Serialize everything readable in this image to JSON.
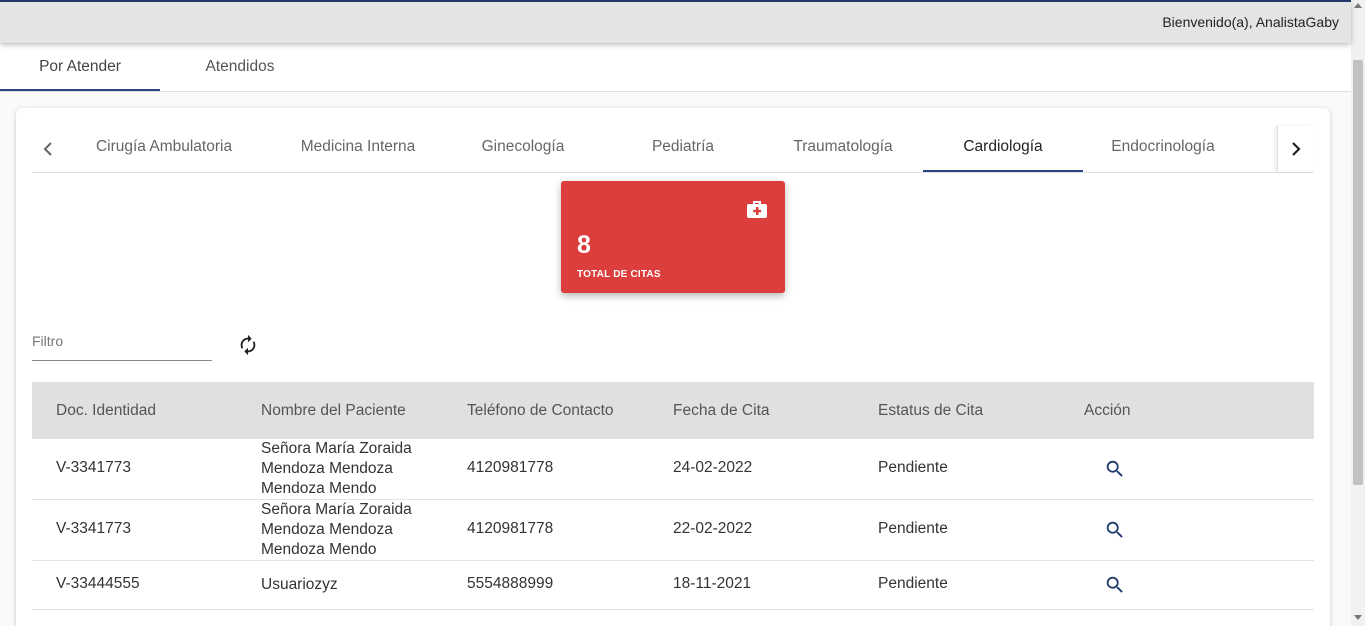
{
  "header": {
    "welcome": "Bienvenido(a), AnalistaGaby"
  },
  "main_tabs": [
    {
      "label": "Por Atender",
      "active": true
    },
    {
      "label": "Atendidos",
      "active": false
    }
  ],
  "specialties": {
    "tabs": [
      "Cirugía Ambulatoria",
      "Medicina Interna",
      "Ginecología",
      "Pediatría",
      "Traumatología",
      "Cardiología",
      "Endocrinología"
    ],
    "active": "Cardiología"
  },
  "stat_card": {
    "value": "8",
    "label": "TOTAL DE CITAS",
    "icon": "medical-kit-icon",
    "color": "#dc3d3d"
  },
  "filter": {
    "placeholder": "Filtro",
    "value": ""
  },
  "table": {
    "headers": [
      "Doc. Identidad",
      "Nombre del Paciente",
      "Teléfono de Contacto",
      "Fecha de Cita",
      "Estatus de Cita",
      "Acción"
    ],
    "rows": [
      {
        "doc": "V-3341773",
        "name": "Señora María Zoraida Mendoza Mendoza Mendoza Mendo",
        "phone": "4120981778",
        "date": "24-02-2022",
        "status": "Pendiente"
      },
      {
        "doc": "V-3341773",
        "name": "Señora María Zoraida Mendoza Mendoza Mendoza Mendo",
        "phone": "4120981778",
        "date": "22-02-2022",
        "status": "Pendiente"
      },
      {
        "doc": "V-33444555",
        "name": "Usuariozyz",
        "phone": "5554888999",
        "date": "18-11-2021",
        "status": "Pendiente"
      }
    ]
  },
  "colors": {
    "accent": "#2a4480",
    "icon": "#1f3a6b",
    "topbar": "#e4e4e4"
  }
}
